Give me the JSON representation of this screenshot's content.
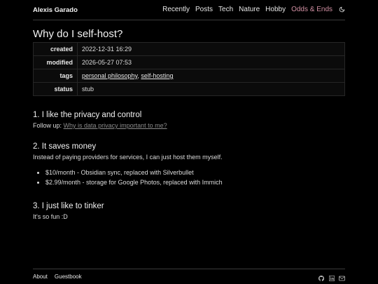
{
  "header": {
    "brand": "Alexis Garado",
    "nav": [
      {
        "label": "Recently"
      },
      {
        "label": "Posts"
      },
      {
        "label": "Tech"
      },
      {
        "label": "Nature"
      },
      {
        "label": "Hobby"
      },
      {
        "label": "Odds & Ends"
      }
    ],
    "active_color": "#d08fa2"
  },
  "page": {
    "title": "Why do I self-host?",
    "meta": {
      "created_key": "created",
      "created": "2022-12-31 16:29",
      "modified_key": "modified",
      "modified": "2026-05-27 07:53",
      "tags_key": "tags",
      "tag1": "personal philosophy",
      "tag_sep": ",",
      "tag2": "self-hosting",
      "status_key": "status",
      "status": "stub"
    },
    "sections": [
      {
        "heading": "1. I like the privacy and control",
        "prefix": "Follow up:",
        "link": "Why is data privacy important to me?"
      },
      {
        "heading": "2. It saves money",
        "text": "Instead of paying providers for services, I can just host them myself.",
        "items": [
          "$10/month - Obsidian sync, replaced with Silverbullet",
          "$2.99/month - storage for Google Photos, replaced with Immich"
        ]
      },
      {
        "heading": "3. I just like to tinker",
        "text": "It's so fun :D"
      }
    ]
  },
  "footer": {
    "about": "About",
    "guestbook": "Guestbook",
    "icons": [
      "github-icon",
      "linkedin-icon",
      "mail-icon"
    ]
  }
}
